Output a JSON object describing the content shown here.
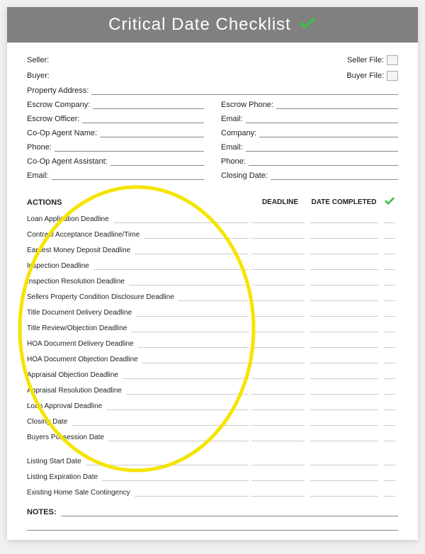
{
  "header": {
    "title": "Critical Date Checklist"
  },
  "fields": {
    "seller": "Seller:",
    "seller_file": "Seller File:",
    "buyer": "Buyer:",
    "buyer_file": "Buyer File:",
    "property_address": "Property Address:",
    "escrow_company": "Escrow Company:",
    "escrow_officer": "Escrow Officer:",
    "coop_agent_name": "Co-Op Agent Name:",
    "phone": "Phone:",
    "coop_agent_assistant": "Co-Op Agent Assistant:",
    "email": "Email:",
    "escrow_phone": "Escrow Phone:",
    "email2": "Email:",
    "company": "Company:",
    "email3": "Email:",
    "phone2": "Phone:",
    "closing_date": "Closing Date:"
  },
  "section_headers": {
    "actions": "ACTIONS",
    "deadline": "DEADLINE",
    "date_completed": "DATE COMPLETED"
  },
  "actions_group1": [
    "Loan Application Deadline",
    "Contract Acceptance Deadline/Time",
    "Earnest Money Deposit Deadline",
    "Inspection Deadline",
    "Inspection Resolution Deadline",
    "Sellers Property Condition Disclosure Deadline",
    "Title Document Delivery Deadline",
    "Title Review/Objection Deadline",
    "HOA Document Delivery Deadline",
    "HOA Document Objection Deadline",
    "Appraisal Objection Deadline",
    "Appraisal Resolution Deadline",
    "Loan Approval Deadline",
    "Closing Date",
    "Buyers Possession Date"
  ],
  "actions_group2": [
    "Listing Start Date",
    "Listing Expiration Date",
    "Existing Home Sale Contingency"
  ],
  "notes_label": "NOTES:"
}
